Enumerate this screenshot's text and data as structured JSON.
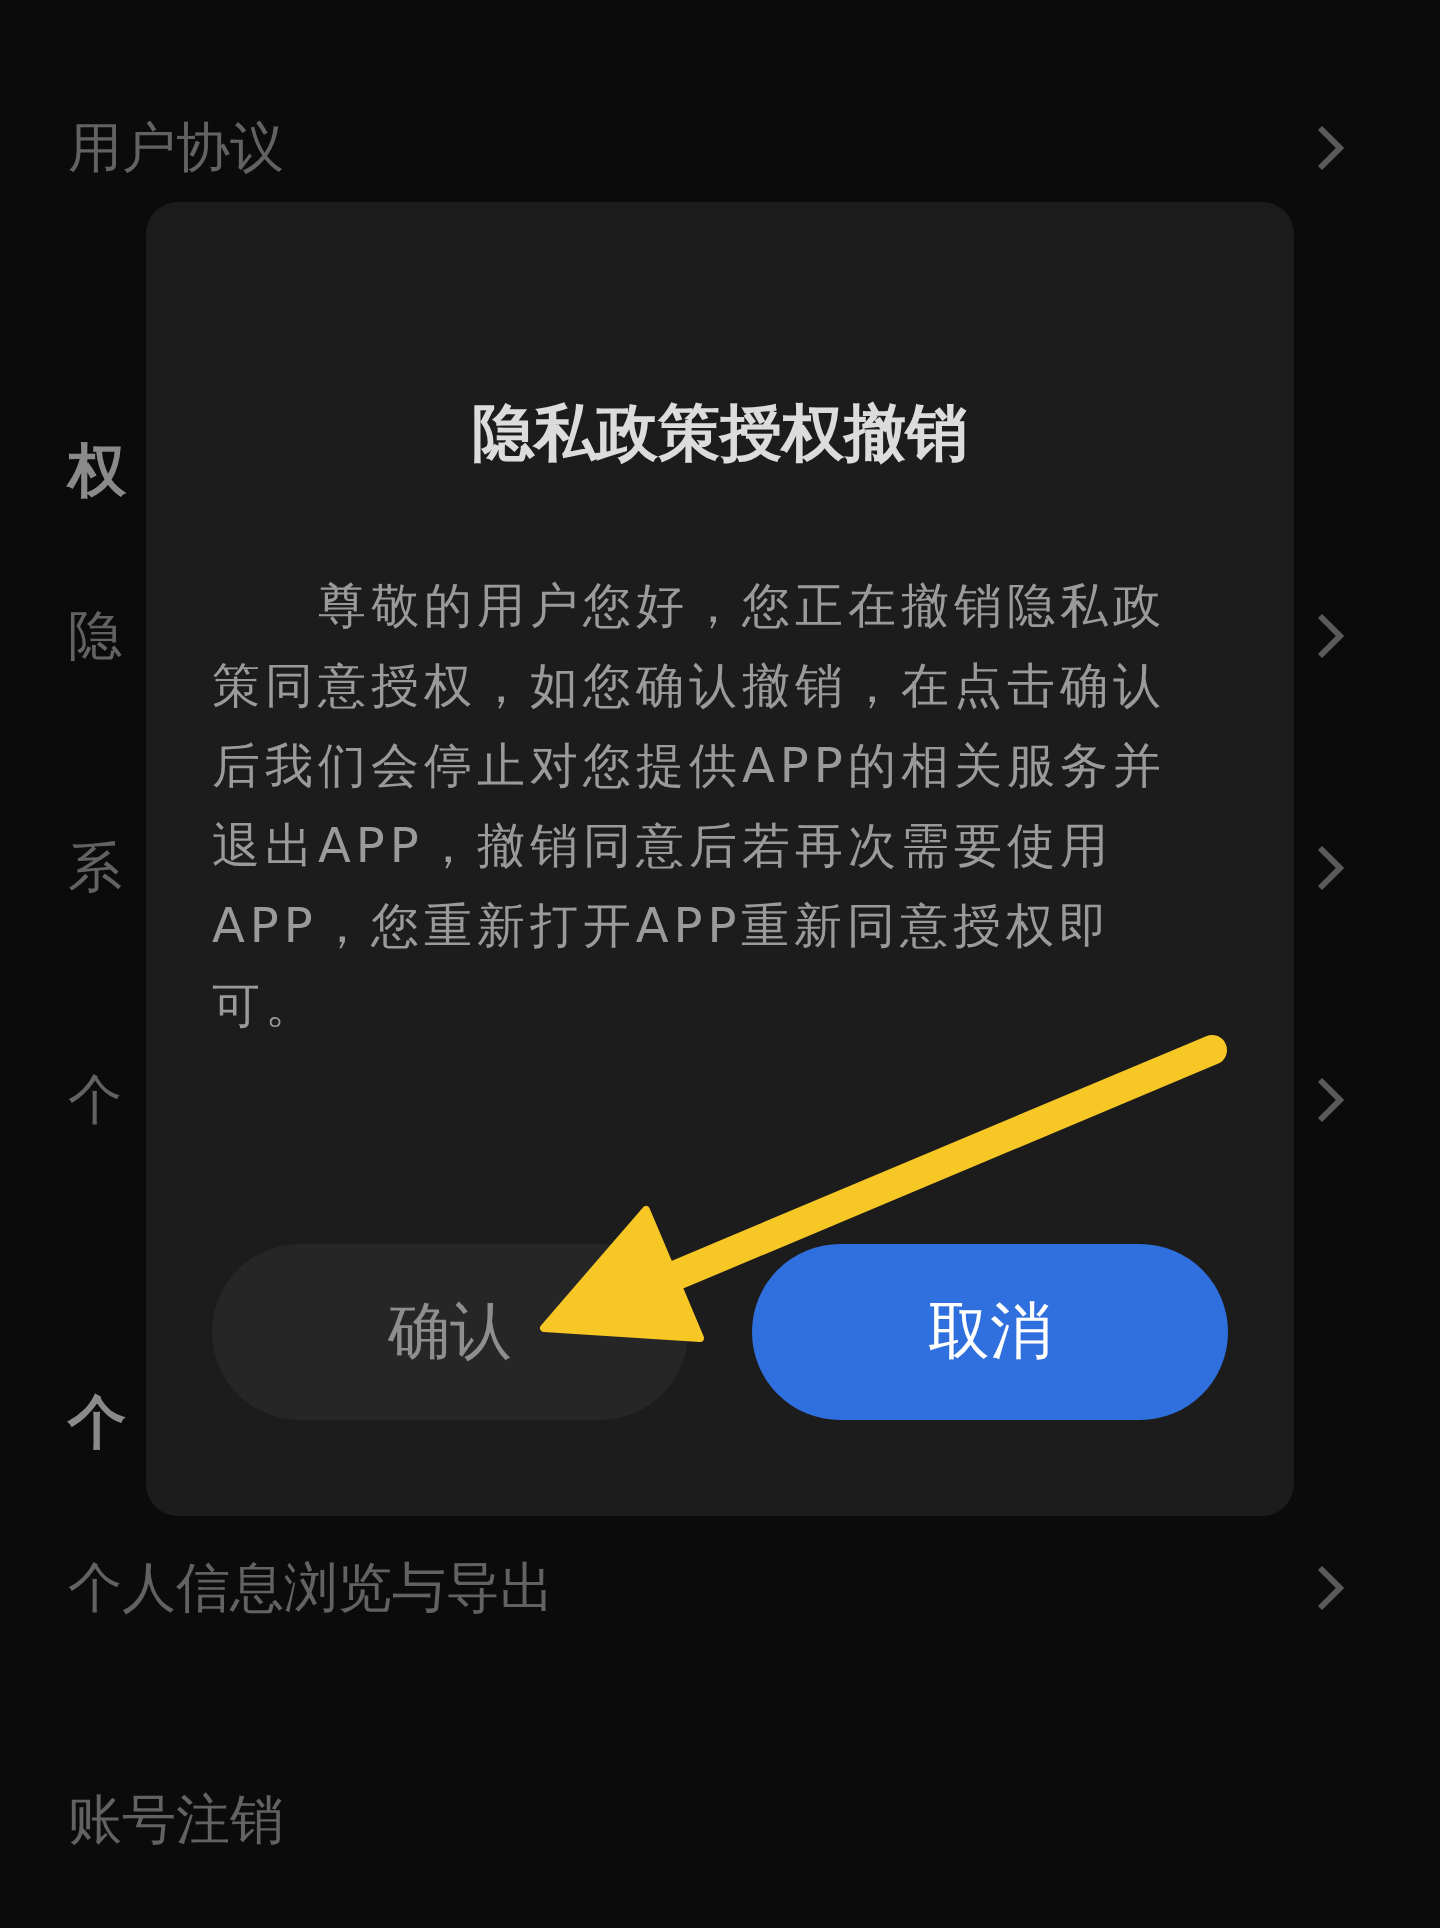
{
  "list": [
    {
      "kind": "item",
      "label": "用户协议",
      "chevron": true
    },
    {
      "kind": "header",
      "label": "权"
    },
    {
      "kind": "item",
      "label": "隐",
      "chevron": true
    },
    {
      "kind": "item",
      "label": "系",
      "chevron": true
    },
    {
      "kind": "item",
      "label": "个",
      "chevron": true
    },
    {
      "kind": "header",
      "label": "个"
    },
    {
      "kind": "item",
      "label": "个人信息浏览与导出",
      "chevron": true
    },
    {
      "kind": "item",
      "label": "账号注销",
      "chevron": false
    }
  ],
  "dialog": {
    "title": "隐私政策授权撤销",
    "message": "尊敬的用户您好，您正在撤销隐私政策同意授权，如您确认撤销，在点击确认后我们会停止对您提供APP的相关服务并退出APP，撤销同意后若再次需要使用APP，您重新打开APP重新同意授权即可。",
    "buttons": [
      {
        "label": "确认",
        "kind": "secondary"
      },
      {
        "label": "取消",
        "kind": "primary"
      }
    ]
  },
  "annotation": {
    "kind": "arrow"
  }
}
